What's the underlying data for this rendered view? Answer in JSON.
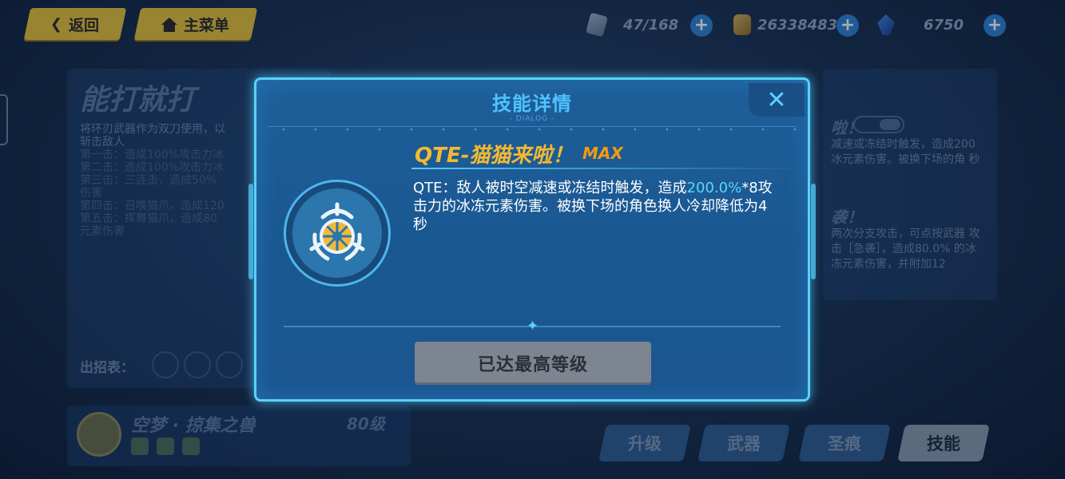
{
  "topbar": {
    "back_label": "返回",
    "menu_label": "主菜单",
    "stamina": "47/168",
    "coins": "26338483",
    "crystals": "6750"
  },
  "background": {
    "skill_title": "能打就打",
    "skill_desc_lines": [
      "将环刃武器作为双刀使用，以",
      "斩击敌人",
      "第一击：造成100%攻击力冰",
      "第二击：造成100%攻击力冰",
      "第三击：三连击，造成50%",
      "伤害",
      "第四击：召唤猫爪，造成120",
      "第五击：挥舞猫爪，造成80",
      "元素伤害"
    ],
    "combo_label": "出招表：",
    "right_title_1": "啦！",
    "right_text_1": "减速或冻结时触发，造成200 冰元素伤害。被换下场的角 秒",
    "right_title_2": "袭！",
    "right_text_2": "两次分支攻击，可点按武器 攻击［急袭］，造成80.0% 的冰冻元素伤害，并附加12 ",
    "character_name": "空梦 · 掠集之兽",
    "character_level": "80级",
    "tabs": [
      "升级",
      "武器",
      "圣痕",
      "技能"
    ]
  },
  "dialog": {
    "title": "技能详情",
    "subtitle": "- DIALOG -",
    "close_glyph": "✕",
    "skill_name_prefix": "QTE",
    "skill_name_rest": "-猫猫来啦！",
    "max_badge": "MAX",
    "desc_part1": "QTE：敌人被时空减速或冻结时触发，造成",
    "desc_highlight": "200.0%",
    "desc_part2": "*8攻击力的冰冻元素伤害。被换下场的角色换人冷却降低为4秒",
    "button_label": "已达最高等级"
  },
  "colors": {
    "accent_blue": "#57d2ff",
    "skill_name": "#f5b930",
    "max_orange": "#f39a12",
    "highlight": "#5ad3ff",
    "button_gray": "#7d8590",
    "top_button_yellow": "#e9c53a"
  },
  "icons": {
    "back": "chevron-left-icon",
    "home": "home-icon",
    "stamina": "stamina-card-icon",
    "coin": "coin-icon",
    "crystal": "crystal-icon",
    "plus": "plus-icon",
    "close": "close-icon",
    "skill": "snowflake-wheel-icon"
  }
}
